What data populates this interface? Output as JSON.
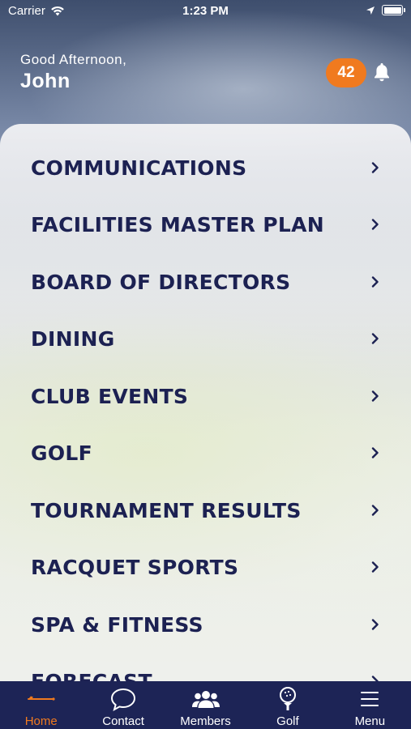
{
  "status_bar": {
    "carrier": "Carrier",
    "time": "1:23 PM"
  },
  "header": {
    "greeting": "Good Afternoon,",
    "name": "John",
    "notification_count": "42"
  },
  "menu": {
    "items": [
      {
        "label": "COMMUNICATIONS"
      },
      {
        "label": "FACILITIES MASTER PLAN"
      },
      {
        "label": "BOARD OF DIRECTORS"
      },
      {
        "label": "DINING"
      },
      {
        "label": "CLUB EVENTS"
      },
      {
        "label": "GOLF"
      },
      {
        "label": "TOURNAMENT RESULTS"
      },
      {
        "label": "RACQUET SPORTS"
      },
      {
        "label": "SPA & FITNESS"
      },
      {
        "label": "FORECAST"
      }
    ]
  },
  "tab_bar": {
    "tabs": [
      {
        "label": "Home",
        "icon": "golf-club-icon",
        "active": true
      },
      {
        "label": "Contact",
        "icon": "chat-bubble-icon",
        "active": false
      },
      {
        "label": "Members",
        "icon": "members-icon",
        "active": false
      },
      {
        "label": "Golf",
        "icon": "golf-ball-tee-icon",
        "active": false
      },
      {
        "label": "Menu",
        "icon": "hamburger-menu-icon",
        "active": false
      }
    ]
  },
  "colors": {
    "accent": "#f07a1f",
    "navy": "#1d2456",
    "menu_text": "#1c2152"
  }
}
